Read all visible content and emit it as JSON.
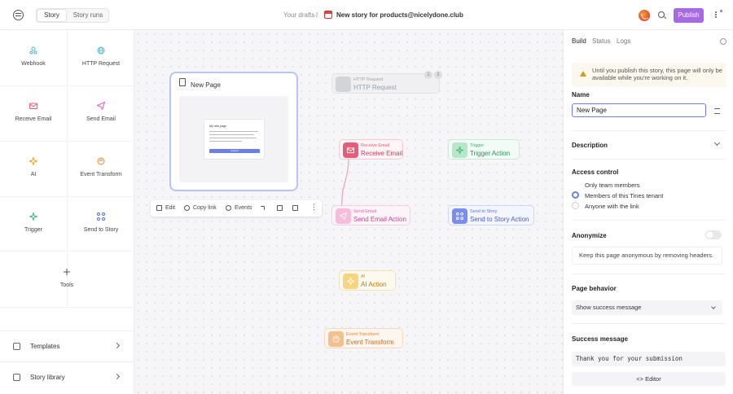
{
  "header": {
    "tabs": [
      {
        "label": "Story"
      },
      {
        "label": "Story runs"
      }
    ],
    "breadcrumb_drafts": "Your drafts",
    "breadcrumb_sep": "/",
    "story_title": "New story for products@nicelydone.club",
    "publish_label": "Publish"
  },
  "palette": {
    "items": [
      {
        "label": "Webhook",
        "icon": "webhook-icon",
        "color": "#4fb6c9"
      },
      {
        "label": "HTTP Request",
        "icon": "http-request-icon",
        "color": "#4fb6c9"
      },
      {
        "label": "Receive Email",
        "icon": "receive-email-icon",
        "color": "#e85b7a"
      },
      {
        "label": "Send Email",
        "icon": "send-email-icon",
        "color": "#e85bb0"
      },
      {
        "label": "AI",
        "icon": "ai-icon",
        "color": "#e8a317"
      },
      {
        "label": "Event Transform",
        "icon": "event-transform-icon",
        "color": "#e8862a"
      },
      {
        "label": "Trigger",
        "icon": "trigger-icon",
        "color": "#3cb371"
      },
      {
        "label": "Send to Story",
        "icon": "send-to-story-icon",
        "color": "#5b6fe8"
      },
      {
        "label": "Tools",
        "icon": "plus-icon",
        "color": "#555555"
      }
    ],
    "templates_label": "Templates",
    "story_library_label": "Story library"
  },
  "canvas": {
    "page_node": {
      "title": "New Page",
      "preview_title": "My new page",
      "preview_button": "Submit"
    },
    "node_toolbar": {
      "edit": "Edit",
      "copy_link": "Copy link",
      "events": "Events"
    },
    "nodes": [
      {
        "type_label": "HTTP Request",
        "name": "HTTP Request",
        "color": "#9aa0a6",
        "badges": [
          "1",
          "2"
        ]
      },
      {
        "type_label": "Receive Email",
        "name": "Receive Email",
        "color": "#e85b7a"
      },
      {
        "type_label": "Trigger",
        "name": "Trigger Action",
        "color": "#3cb371"
      },
      {
        "type_label": "Send Email",
        "name": "Send Email Action",
        "color": "#e85bb0"
      },
      {
        "type_label": "Send to Story",
        "name": "Send to Story Action",
        "color": "#5b6fe8"
      },
      {
        "type_label": "AI",
        "name": "AI Action",
        "color": "#e8a317"
      },
      {
        "type_label": "Event Transform",
        "name": "Event Transform",
        "color": "#e8862a"
      }
    ]
  },
  "panel": {
    "tabs": [
      {
        "label": "Build"
      },
      {
        "label": "Status"
      },
      {
        "label": "Logs"
      }
    ],
    "warning": "Until you publish this story, this page will only be available while you're working on it.",
    "name_label": "Name",
    "name_value": "New Page",
    "description_label": "Description",
    "access_label": "Access control",
    "access_options": [
      {
        "label": "Only team members",
        "selected": false
      },
      {
        "label": "Members of this Tines tenant",
        "selected": true
      },
      {
        "label": "Anyone with the link",
        "selected": false
      }
    ],
    "anonymize_label": "Anonymize",
    "anonymize_on": false,
    "anonymize_note": "Keep this page anonymous by removing headers.",
    "behavior_label": "Page behavior",
    "behavior_value": "Show success message",
    "success_label": "Success message",
    "success_value": "Thank you for your submission",
    "editor_label": "Editor"
  },
  "colors": {
    "accent": "#a66be3",
    "selection": "#b9c4f6",
    "focus": "#6b7fe8"
  }
}
